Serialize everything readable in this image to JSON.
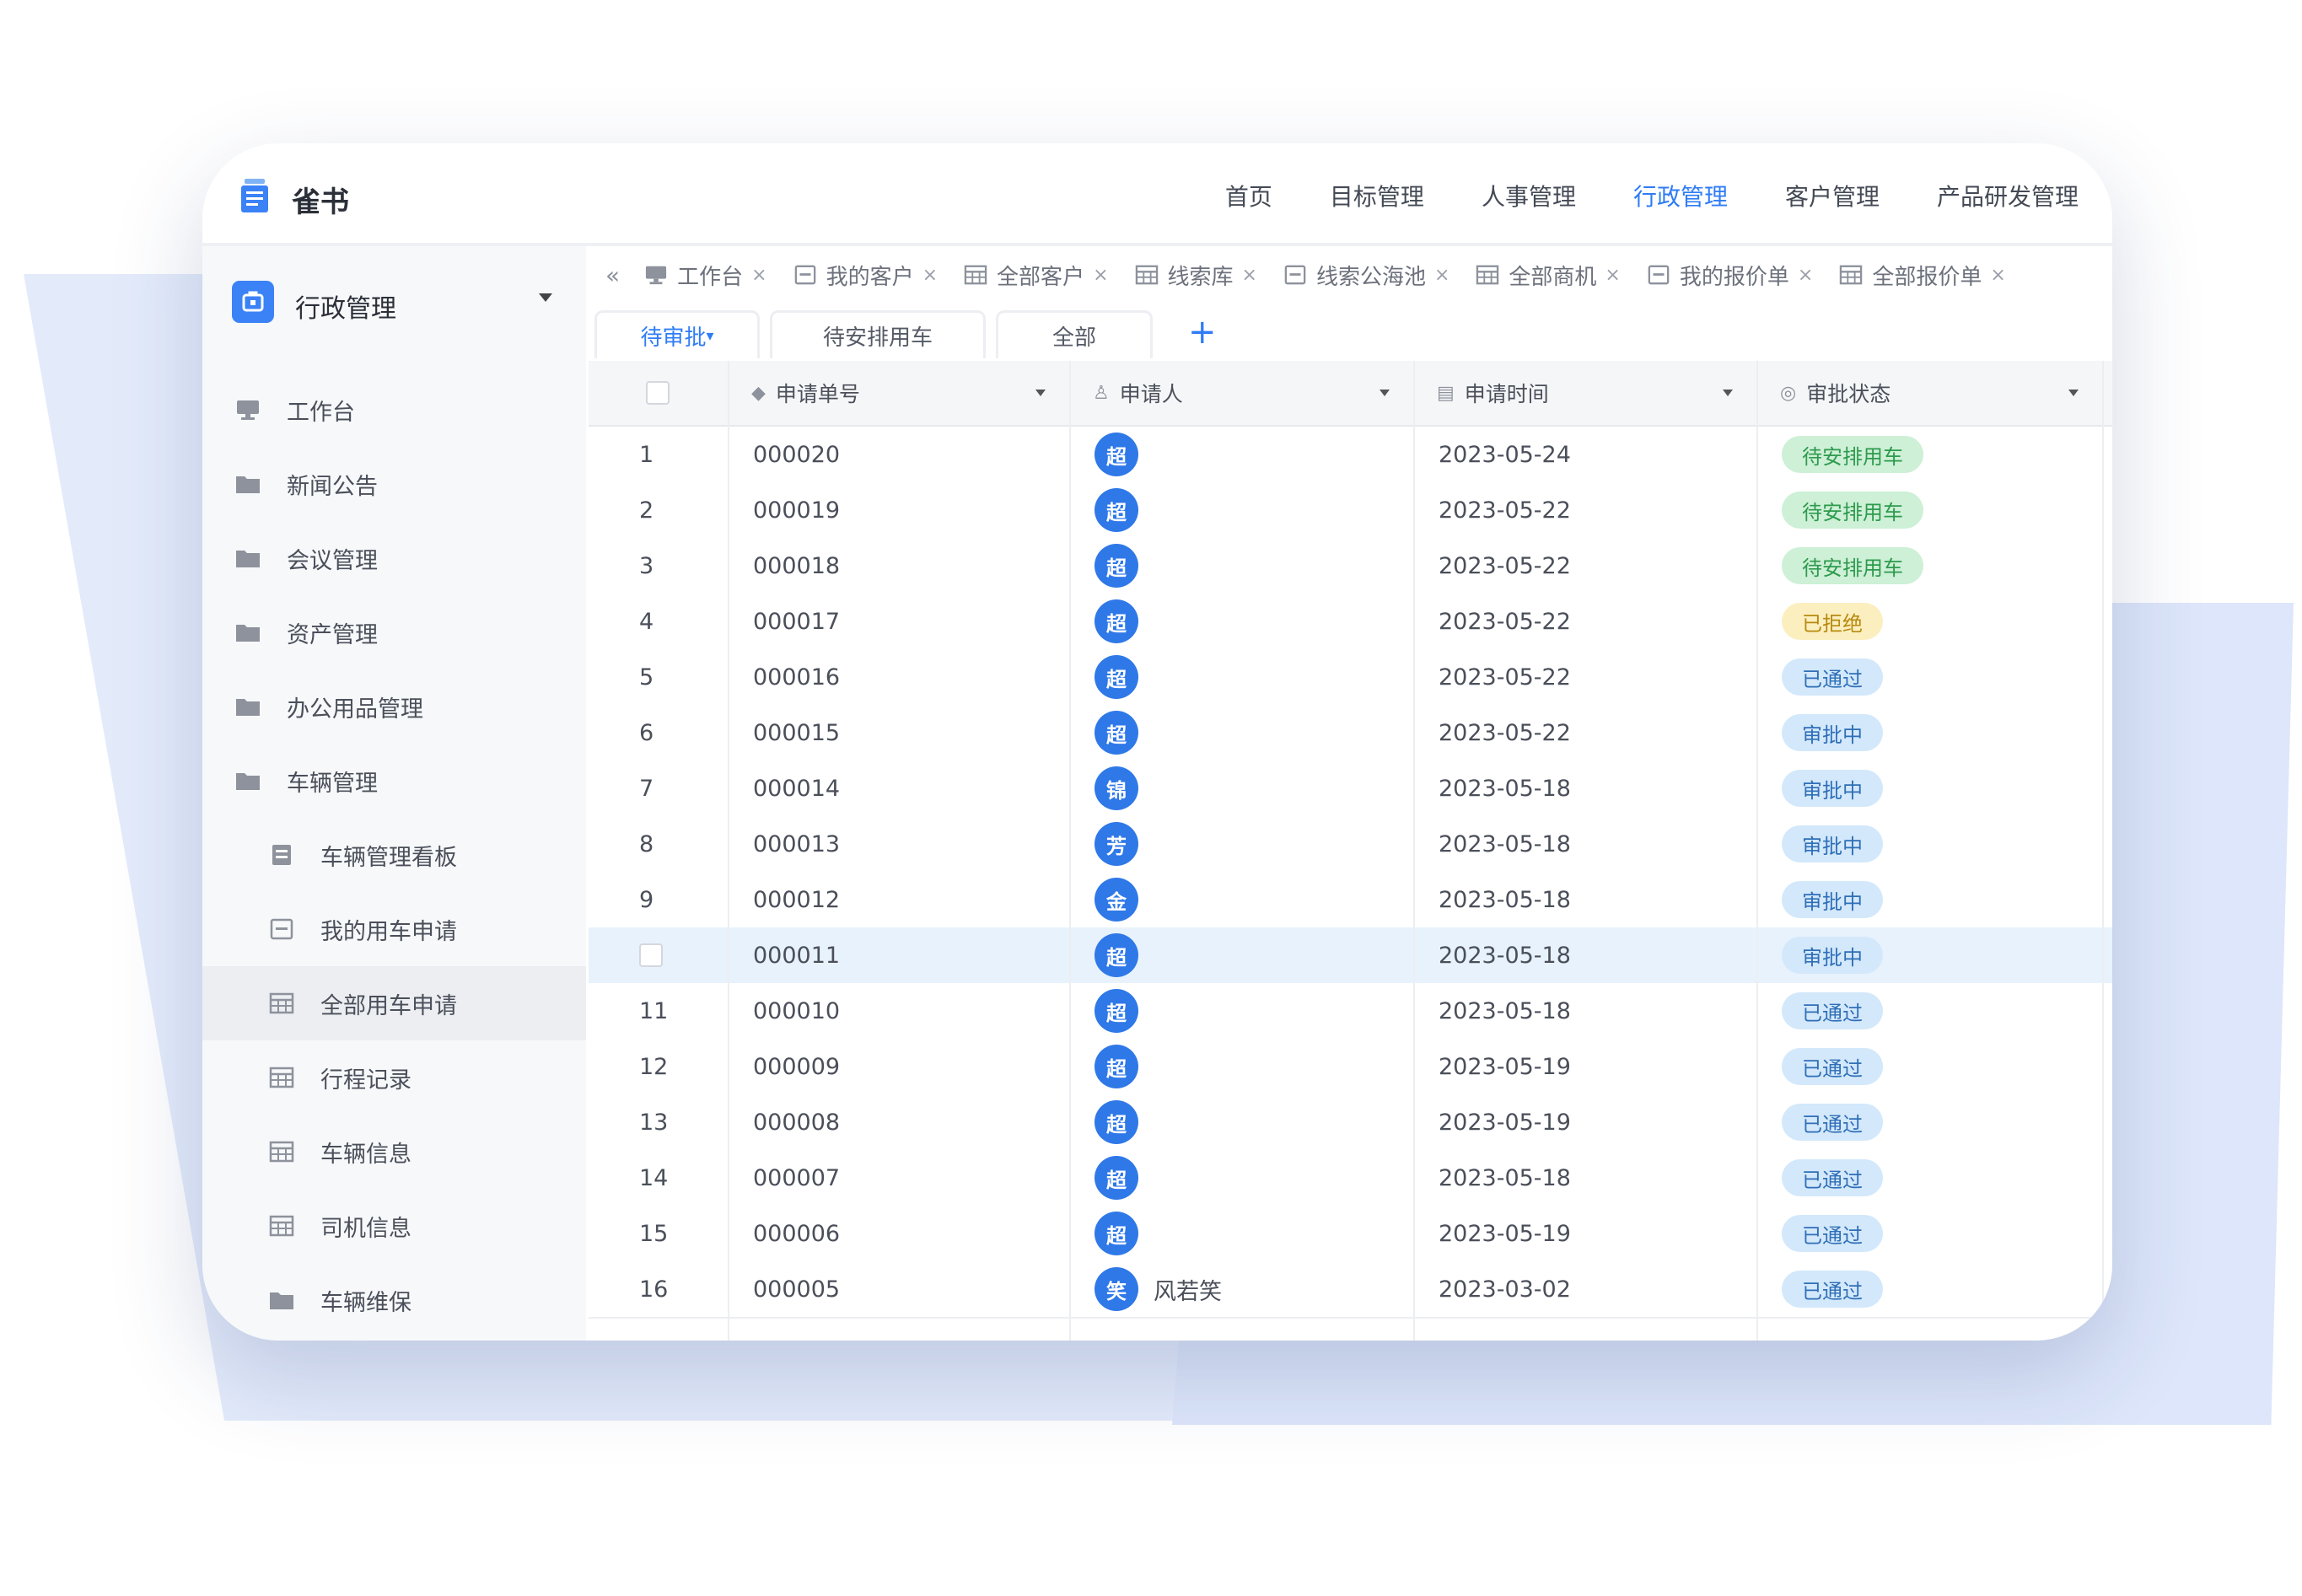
{
  "app": {
    "brand": "雀书",
    "nav": [
      {
        "label": "首页",
        "active": false
      },
      {
        "label": "目标管理",
        "active": false
      },
      {
        "label": "人事管理",
        "active": false
      },
      {
        "label": "行政管理",
        "active": true
      },
      {
        "label": "客户管理",
        "active": false
      },
      {
        "label": "产品研发管理",
        "active": false
      }
    ]
  },
  "sidebar": {
    "title": "行政管理",
    "items": [
      {
        "label": "工作台",
        "icon": "workbench-icon",
        "level": 0
      },
      {
        "label": "新闻公告",
        "icon": "folder-icon",
        "level": 0
      },
      {
        "label": "会议管理",
        "icon": "folder-icon",
        "level": 0
      },
      {
        "label": "资产管理",
        "icon": "folder-icon",
        "level": 0
      },
      {
        "label": "办公用品管理",
        "icon": "folder-icon",
        "level": 0
      },
      {
        "label": "车辆管理",
        "icon": "folder-open-icon",
        "level": 0
      },
      {
        "label": "车辆管理看板",
        "icon": "dashboard-icon",
        "level": 1
      },
      {
        "label": "我的用车申请",
        "icon": "form-icon",
        "level": 1
      },
      {
        "label": "全部用车申请",
        "icon": "table-icon",
        "level": 1,
        "active": true
      },
      {
        "label": "行程记录",
        "icon": "table-icon",
        "level": 1
      },
      {
        "label": "车辆信息",
        "icon": "table-icon",
        "level": 1
      },
      {
        "label": "司机信息",
        "icon": "table-icon",
        "level": 1
      },
      {
        "label": "车辆维保",
        "icon": "folder-icon",
        "level": 1
      }
    ]
  },
  "tabs": [
    {
      "label": "工作台",
      "icon": "workbench-icon"
    },
    {
      "label": "我的客户",
      "icon": "form-icon"
    },
    {
      "label": "全部客户",
      "icon": "table-icon"
    },
    {
      "label": "线索库",
      "icon": "table-icon"
    },
    {
      "label": "线索公海池",
      "icon": "form-icon"
    },
    {
      "label": "全部商机",
      "icon": "table-icon"
    },
    {
      "label": "我的报价单",
      "icon": "form-icon"
    },
    {
      "label": "全部报价单",
      "icon": "table-icon"
    }
  ],
  "views": [
    {
      "label": "待审批",
      "active": true
    },
    {
      "label": "待安排用车",
      "active": false
    },
    {
      "label": "全部",
      "active": false
    }
  ],
  "table": {
    "columns": [
      "申请单号",
      "申请人",
      "申请时间",
      "审批状态"
    ],
    "rows": [
      {
        "no": "1",
        "id": "000020",
        "avatar": "超",
        "name": "",
        "date": "2023-05-24",
        "status": "待安排用车",
        "tone": "green"
      },
      {
        "no": "2",
        "id": "000019",
        "avatar": "超",
        "name": "",
        "date": "2023-05-22",
        "status": "待安排用车",
        "tone": "green"
      },
      {
        "no": "3",
        "id": "000018",
        "avatar": "超",
        "name": "",
        "date": "2023-05-22",
        "status": "待安排用车",
        "tone": "green"
      },
      {
        "no": "4",
        "id": "000017",
        "avatar": "超",
        "name": "",
        "date": "2023-05-22",
        "status": "已拒绝",
        "tone": "yellow"
      },
      {
        "no": "5",
        "id": "000016",
        "avatar": "超",
        "name": "",
        "date": "2023-05-22",
        "status": "已通过",
        "tone": "blue"
      },
      {
        "no": "6",
        "id": "000015",
        "avatar": "超",
        "name": "",
        "date": "2023-05-22",
        "status": "审批中",
        "tone": "blue"
      },
      {
        "no": "7",
        "id": "000014",
        "avatar": "锦",
        "name": "",
        "date": "2023-05-18",
        "status": "审批中",
        "tone": "blue"
      },
      {
        "no": "8",
        "id": "000013",
        "avatar": "芳",
        "name": "",
        "date": "2023-05-18",
        "status": "审批中",
        "tone": "blue"
      },
      {
        "no": "9",
        "id": "000012",
        "avatar": "金",
        "name": "",
        "date": "2023-05-18",
        "status": "审批中",
        "tone": "blue"
      },
      {
        "no": "",
        "id": "000011",
        "avatar": "超",
        "name": "",
        "date": "2023-05-18",
        "status": "审批中",
        "tone": "blue",
        "selected": true
      },
      {
        "no": "11",
        "id": "000010",
        "avatar": "超",
        "name": "",
        "date": "2023-05-18",
        "status": "已通过",
        "tone": "blue"
      },
      {
        "no": "12",
        "id": "000009",
        "avatar": "超",
        "name": "",
        "date": "2023-05-19",
        "status": "已通过",
        "tone": "blue"
      },
      {
        "no": "13",
        "id": "000008",
        "avatar": "超",
        "name": "",
        "date": "2023-05-19",
        "status": "已通过",
        "tone": "blue"
      },
      {
        "no": "14",
        "id": "000007",
        "avatar": "超",
        "name": "",
        "date": "2023-05-18",
        "status": "已通过",
        "tone": "blue"
      },
      {
        "no": "15",
        "id": "000006",
        "avatar": "超",
        "name": "",
        "date": "2023-05-19",
        "status": "已通过",
        "tone": "blue"
      },
      {
        "no": "16",
        "id": "000005",
        "avatar": "笑",
        "name": "风若笑",
        "date": "2023-03-02",
        "status": "已通过",
        "tone": "blue"
      }
    ]
  }
}
